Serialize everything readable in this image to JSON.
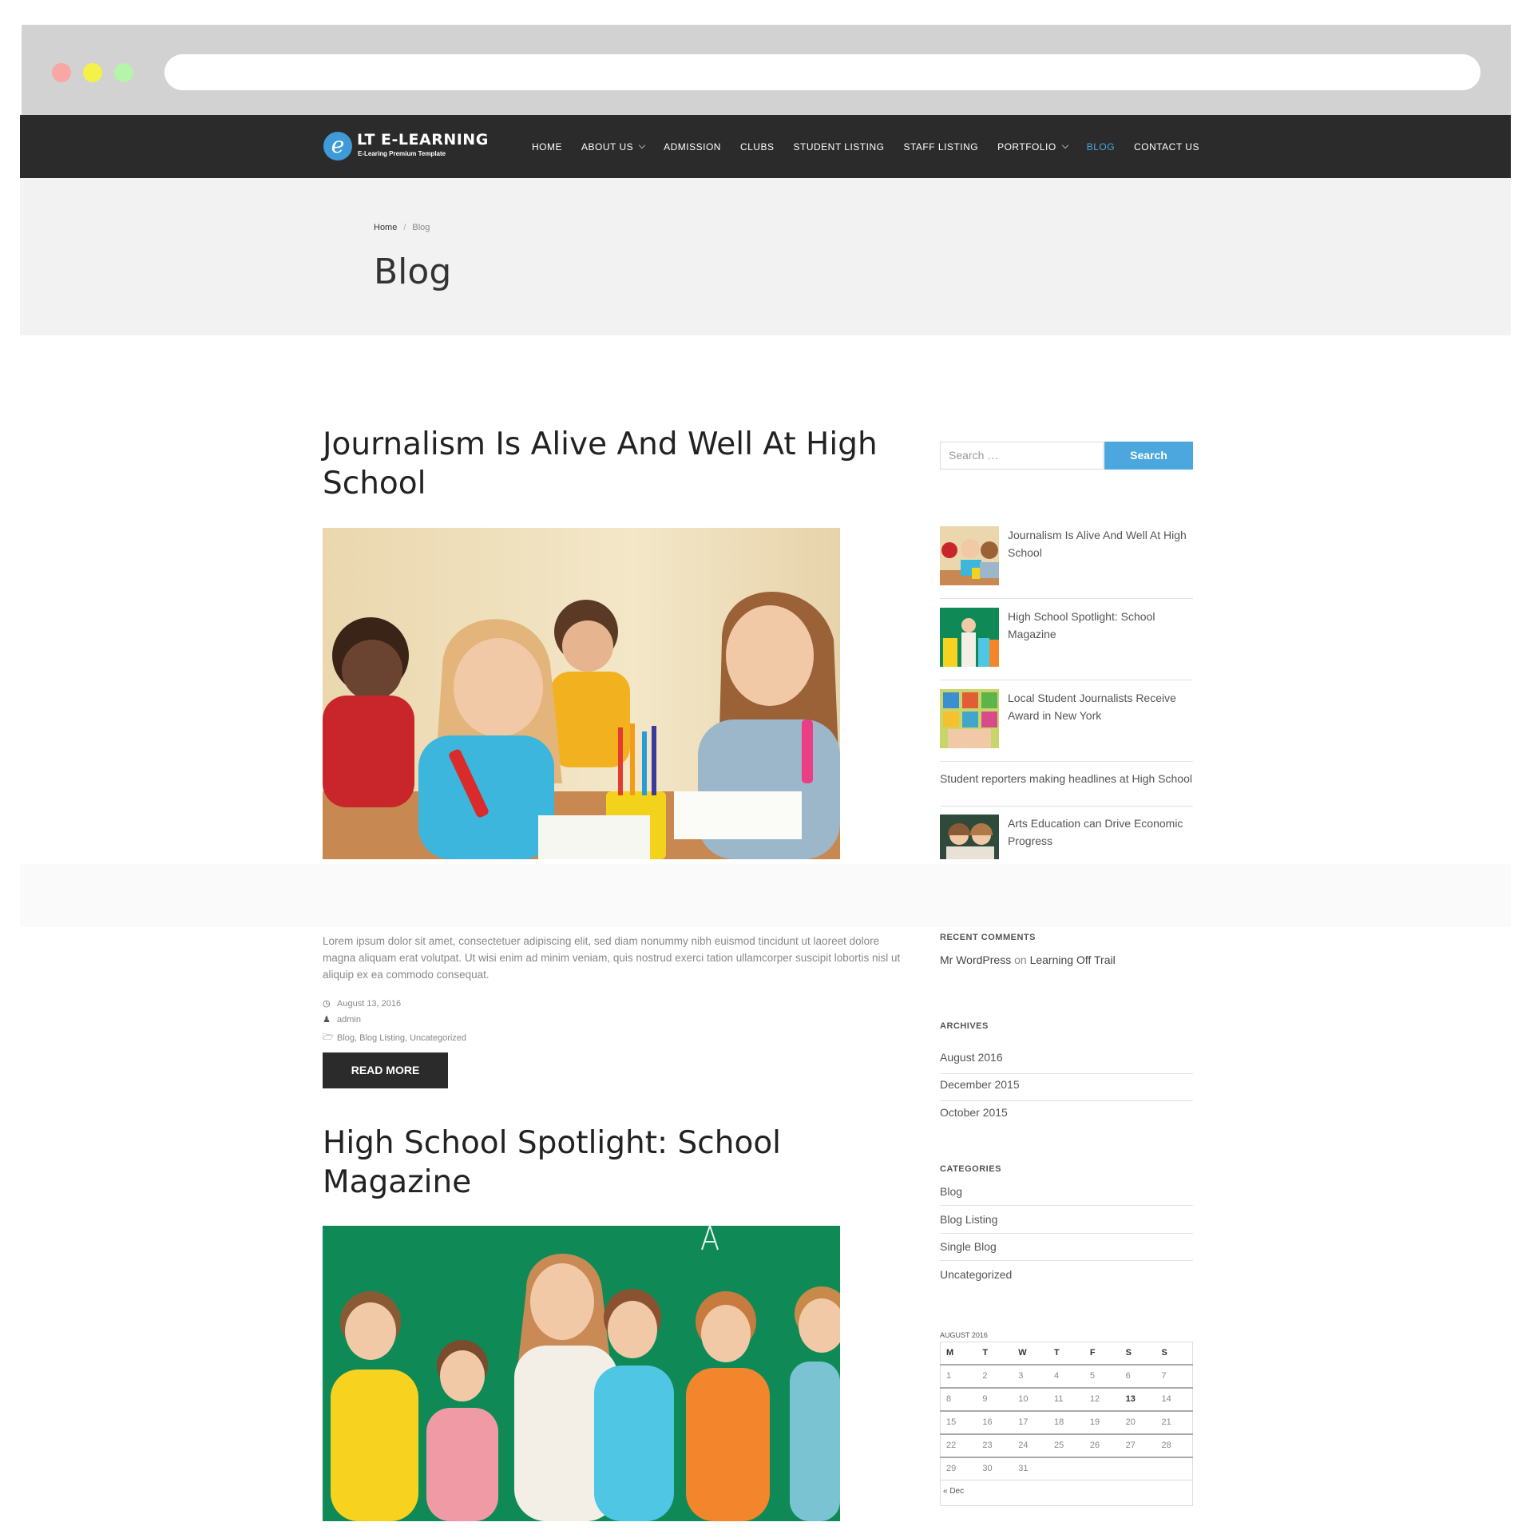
{
  "nav": {
    "logo_title": "LT E-LEARNING",
    "logo_sub": "E-Learing Premium Template",
    "items": [
      {
        "label": "Home",
        "dropdown": false,
        "active": false
      },
      {
        "label": "About Us",
        "dropdown": true,
        "active": false
      },
      {
        "label": "Admission",
        "dropdown": false,
        "active": false
      },
      {
        "label": "Clubs",
        "dropdown": false,
        "active": false
      },
      {
        "label": "Student Listing",
        "dropdown": false,
        "active": false
      },
      {
        "label": "Staff Listing",
        "dropdown": false,
        "active": false
      },
      {
        "label": "Portfolio",
        "dropdown": true,
        "active": false
      },
      {
        "label": "Blog",
        "dropdown": false,
        "active": true
      },
      {
        "label": "Contact Us",
        "dropdown": false,
        "active": false
      }
    ]
  },
  "header": {
    "crumb_home": "Home",
    "crumb_sep": "/",
    "crumb_current": "Blog",
    "title": "Blog"
  },
  "posts": [
    {
      "title": "Journalism Is Alive And Well At High School",
      "excerpt": "Lorem ipsum dolor sit amet, consectetuer adipiscing elit, sed diam nonummy nibh euismod tincidunt ut laoreet dolore magna aliquam erat volutpat. Ut wisi enim ad minim veniam, quis nostrud exerci tation ullamcorper suscipit lobortis nisl ut aliquip ex ea commodo consequat.",
      "date": "August 13, 2016",
      "author": "admin",
      "categories": "Blog, Blog Listing, Uncategorized",
      "read_more": "READ MORE"
    },
    {
      "title": "High School Spotlight: School Magazine"
    }
  ],
  "sidebar": {
    "search_placeholder": "Search …",
    "search_button": "Search",
    "recent_posts": [
      "Journalism Is Alive And Well At High School",
      "High School Spotlight: School Magazine",
      "Local Student Journalists Receive Award in New York",
      "Student reporters making headlines at High School",
      "Arts Education can Drive Economic Progress"
    ],
    "recent_comments_title": "RECENT COMMENTS",
    "comment_author": "Mr WordPress",
    "comment_on": "on",
    "comment_post": "Learning Off Trail",
    "archives_title": "ARCHIVES",
    "archives": [
      "August 2016",
      "December 2015",
      "October 2015"
    ],
    "categories_title": "CATEGORIES",
    "categories": [
      "Blog",
      "Blog Listing",
      "Single Blog",
      "Uncategorized"
    ],
    "calendar": {
      "caption": "AUGUST 2016",
      "days": [
        "M",
        "T",
        "W",
        "T",
        "F",
        "S",
        "S"
      ],
      "weeks": [
        [
          "1",
          "2",
          "3",
          "4",
          "5",
          "6",
          "7"
        ],
        [
          "8",
          "9",
          "10",
          "11",
          "12",
          "13",
          "14"
        ],
        [
          "15",
          "16",
          "17",
          "18",
          "19",
          "20",
          "21"
        ],
        [
          "22",
          "23",
          "24",
          "25",
          "26",
          "27",
          "28"
        ],
        [
          "29",
          "30",
          "31",
          "",
          "",
          "",
          ""
        ]
      ],
      "highlight": "13",
      "prev": "« Dec"
    }
  },
  "colors": {
    "nav_bg": "#2b2b2b",
    "accent": "#4ca7de",
    "header_bg": "#f2f2f2"
  }
}
